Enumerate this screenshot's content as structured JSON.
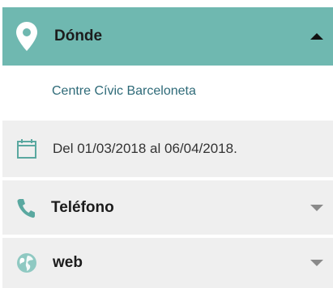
{
  "where": {
    "title": "Dónde",
    "venue": "Centre Cívic Barceloneta",
    "icon": "location-pin-icon"
  },
  "dates": {
    "text": "Del 01/03/2018 al 06/04/2018.",
    "icon": "calendar-icon"
  },
  "phone": {
    "title": "Teléfono",
    "icon": "phone-icon"
  },
  "web": {
    "title": "web",
    "icon": "globe-icon"
  },
  "colors": {
    "accent": "#6fb8b0",
    "link": "#2e6a78",
    "section_bg": "#efefef",
    "icon_teal": "#5aa8a0"
  }
}
